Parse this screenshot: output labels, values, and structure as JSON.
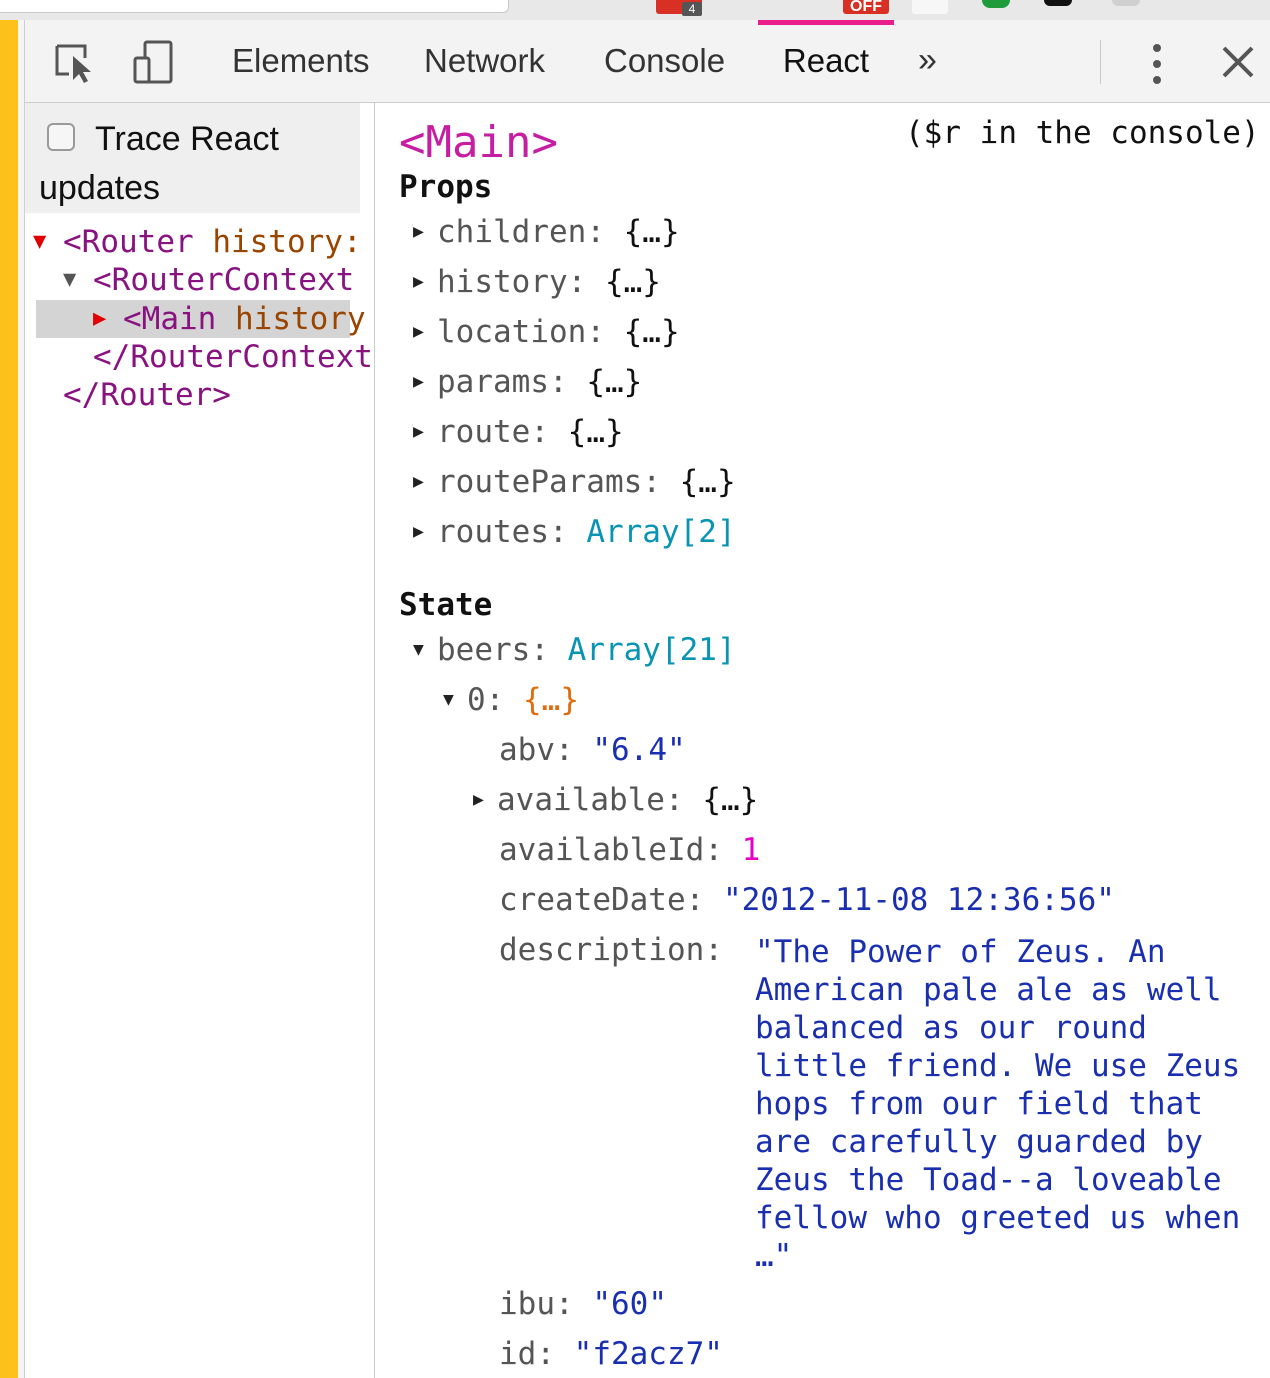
{
  "chrome": {
    "extensions": [
      {
        "name": "gmail",
        "badge": "4",
        "color": "#d93025"
      },
      {
        "name": "off-extension",
        "label": "OFF",
        "color": "#d93025"
      }
    ]
  },
  "toolbar": {
    "tabs": [
      "Elements",
      "Network",
      "Console",
      "React"
    ],
    "active_tab": "React",
    "active_accent": "#e91e8c",
    "more_label": "»"
  },
  "tree_pane": {
    "trace_label": "Trace React updates",
    "trace_checked": false,
    "rows": [
      {
        "arrow": "▼",
        "tag": "<Router",
        "attr": " history:"
      },
      {
        "arrow": "▼",
        "tag": "<RouterContext",
        "attr": ""
      },
      {
        "arrow": "▶",
        "tag": "<Main",
        "attr": " history"
      },
      {
        "arrow": "",
        "tag": "</RouterContext",
        "attr": ""
      },
      {
        "arrow": "",
        "tag": "</Router>",
        "attr": ""
      }
    ]
  },
  "details": {
    "component": "<Main>",
    "console_hint": "($r in the console)",
    "props_title": "Props",
    "props": [
      {
        "key": "children",
        "value": "{…}",
        "type": "obj"
      },
      {
        "key": "history",
        "value": "{…}",
        "type": "obj"
      },
      {
        "key": "location",
        "value": "{…}",
        "type": "obj"
      },
      {
        "key": "params",
        "value": "{…}",
        "type": "obj"
      },
      {
        "key": "route",
        "value": "{…}",
        "type": "obj"
      },
      {
        "key": "routeParams",
        "value": "{…}",
        "type": "obj"
      },
      {
        "key": "routes",
        "value": "Array[2]",
        "type": "arr"
      }
    ],
    "state_title": "State",
    "state": {
      "beers_key": "beers",
      "beers_value": "Array[21]",
      "item_key": "0",
      "item_value": "{…}",
      "fields": {
        "abv_key": "abv",
        "abv_value": "\"6.4\"",
        "available_key": "available",
        "available_value": "{…}",
        "availableId_key": "availableId",
        "availableId_value": "1",
        "createDate_key": "createDate",
        "createDate_value": "\"2012-11-08 12:36:56\"",
        "description_key": "description",
        "description_value": "\"The Power of Zeus. An\nAmerican pale ale as well\nbalanced as our round\nlittle friend. We use Zeus\nhops from our field that\nare carefully guarded by\nZeus the Toad--a loveable\nfellow who greeted us when\n…\"",
        "ibu_key": "ibu",
        "ibu_value": "\"60\"",
        "id_key": "id",
        "id_value": "\"f2acz7\""
      }
    }
  }
}
